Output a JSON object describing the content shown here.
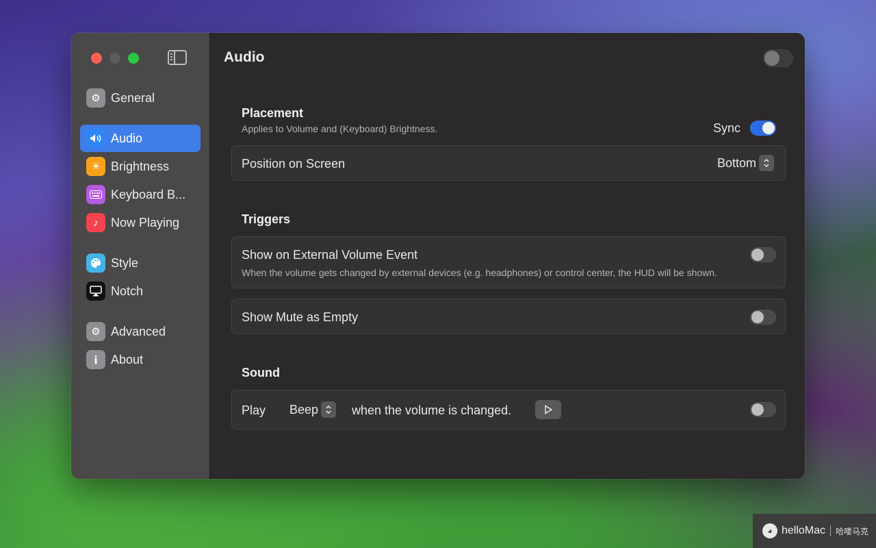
{
  "sidebar": {
    "items": [
      {
        "label": "General",
        "icon": "gear-icon",
        "color": "#8e8e93"
      },
      {
        "label": "Audio",
        "icon": "speaker-icon",
        "color": "#2f86f6",
        "active": true
      },
      {
        "label": "Brightness",
        "icon": "sun-icon",
        "color": "#f7a21b"
      },
      {
        "label": "Keyboard B...",
        "icon": "keyboard-icon",
        "color": "#b55be0"
      },
      {
        "label": "Now Playing",
        "icon": "music-note-icon",
        "color": "#f2434f"
      },
      {
        "label": "Style",
        "icon": "palette-icon",
        "color": "#43b4e6"
      },
      {
        "label": "Notch",
        "icon": "display-icon",
        "color": "#111111"
      },
      {
        "label": "Advanced",
        "icon": "gears-icon",
        "color": "#8e8e93"
      },
      {
        "label": "About",
        "icon": "info-icon",
        "color": "#8e8e93"
      }
    ]
  },
  "main": {
    "title": "Audio",
    "header_toggle_on": false,
    "placement": {
      "title": "Placement",
      "subtitle": "Applies to Volume and (Keyboard) Brightness.",
      "sync_label": "Sync",
      "sync_on": true,
      "position_label": "Position on Screen",
      "position_value": "Bottom"
    },
    "triggers": {
      "title": "Triggers",
      "external_label": "Show on External Volume Event",
      "external_desc": "When the volume gets changed by external devices (e.g. headphones) or control center, the HUD will be shown.",
      "external_on": false,
      "mute_label": "Show Mute as Empty",
      "mute_on": false
    },
    "sound": {
      "title": "Sound",
      "play_label": "Play",
      "sound_value": "Beep",
      "suffix": "when the volume is changed.",
      "enabled": false
    }
  },
  "watermark": {
    "brand": "helloMac",
    "cn": "哈喽马克"
  },
  "colors": {
    "accent": "#3f7ee8",
    "toggle_on": "#2d6ce4",
    "sidebar_bg": "#4a4848",
    "content_bg": "#2b2929"
  }
}
